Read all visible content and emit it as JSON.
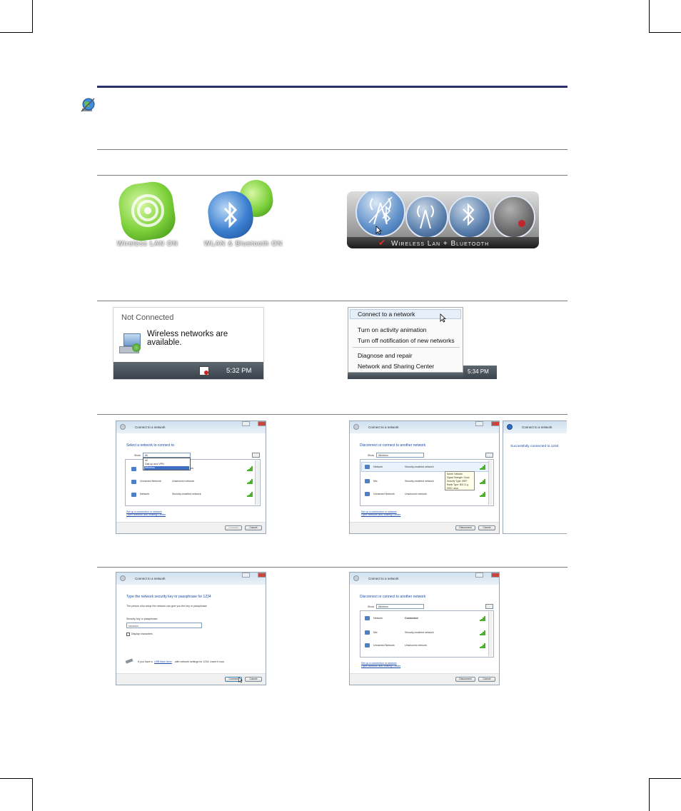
{
  "icon": {
    "note": "note-globe-icon"
  },
  "logos": {
    "wlan_label": "Wireless LAN ON",
    "wlan_bt_label": "WLAN & Bluetooth ON",
    "osd_label": "Wireless Lan + Bluetooth"
  },
  "notification": {
    "title": "Not Connected",
    "message": "Wireless networks are available.",
    "time": "5:32 PM"
  },
  "context_menu": {
    "items": [
      "Connect to a network",
      "Turn on activity animation",
      "Turn off notification of new networks",
      "Diagnose and repair",
      "Network and Sharing Center"
    ],
    "time": "5:34 PM"
  },
  "dialog1": {
    "title": "Connect to a network",
    "heading": "Select a network to connect to",
    "show_label": "Show",
    "show_value": "All",
    "dropdown_options": [
      "All",
      "Dial-up and VPN",
      "Wireless"
    ],
    "rows": [
      {
        "name": "Network",
        "security": ""
      },
      {
        "name": "Unnamed Network",
        "security": "Unsecured network"
      },
      {
        "name": "Network",
        "security": "Security-enabled network"
      }
    ],
    "links": [
      "Set up a connection or network",
      "Open Network and Sharing Center"
    ],
    "buttons": [
      "Connect",
      "Cancel"
    ]
  },
  "dialog2": {
    "title": "Connect to a network",
    "heading": "Disconnect or connect to another network",
    "show_label": "Show",
    "show_value": "Wireless",
    "rows": [
      {
        "name": "Network",
        "security": "Security-enabled network"
      },
      {
        "name": "Mic",
        "security": "Security-enabled network"
      },
      {
        "name": "Unnamed Network",
        "security": "Unsecured network"
      }
    ],
    "tooltip": [
      "Name: Network",
      "Signal Strength: Good",
      "Security Type: WEP",
      "Radio Type: 802.11 g",
      "SSID: asus"
    ],
    "links": [
      "Set up a connection or network",
      "Open Network and Sharing Center"
    ],
    "buttons": [
      "Disconnect",
      "Cancel"
    ]
  },
  "dialog3": {
    "title": "Connect to a network",
    "message": "Successfully connected to 1234"
  },
  "dialog4": {
    "title": "Connect to a network",
    "heading": "Type the network security key or passphrase for 1234",
    "subtext": "The person who setup the network can give you the key or passphrase.",
    "field_label": "Security key or passphrase:",
    "field_value": "••••••••••",
    "checkbox_label": "Display characters",
    "usb_prefix": "If you have a",
    "usb_link": "USB flash drive",
    "usb_suffix": "with network settings for 1234, insert it now.",
    "buttons": [
      "Connect",
      "Cancel"
    ]
  },
  "dialog5": {
    "title": "Connect to a network",
    "heading": "Disconnect or connect to another network",
    "show_label": "Show",
    "show_value": "Wireless",
    "rows": [
      {
        "name": "Network",
        "security": "Connected"
      },
      {
        "name": "Mic",
        "security": "Security-enabled network"
      },
      {
        "name": "Unnamed Network",
        "security": "Unsecured network"
      }
    ],
    "links": [
      "Set up a connection or network",
      "Open Network and Sharing Center"
    ],
    "buttons": [
      "Disconnect",
      "Cancel"
    ]
  }
}
